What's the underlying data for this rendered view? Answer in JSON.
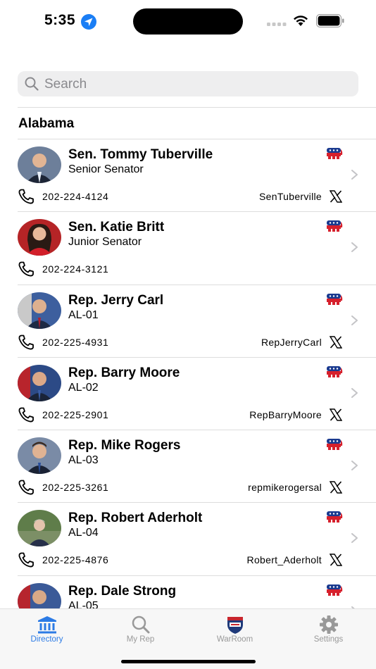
{
  "status_bar": {
    "time": "5:35"
  },
  "search": {
    "placeholder": "Search"
  },
  "section": {
    "header": "Alabama"
  },
  "members": [
    {
      "name": "Sen. Tommy Tuberville",
      "title": "Senior Senator",
      "phone": "202-224-4124",
      "twitter": "SenTuberville",
      "party": "republican"
    },
    {
      "name": "Sen. Katie Britt",
      "title": "Junior Senator",
      "phone": "202-224-3121",
      "twitter": "",
      "party": "republican"
    },
    {
      "name": "Rep. Jerry Carl",
      "title": "AL-01",
      "phone": "202-225-4931",
      "twitter": "RepJerryCarl",
      "party": "republican"
    },
    {
      "name": "Rep. Barry Moore",
      "title": "AL-02",
      "phone": "202-225-2901",
      "twitter": "RepBarryMoore",
      "party": "republican"
    },
    {
      "name": "Rep. Mike Rogers",
      "title": "AL-03",
      "phone": "202-225-3261",
      "twitter": "repmikerogersal",
      "party": "republican"
    },
    {
      "name": "Rep. Robert Aderholt",
      "title": "AL-04",
      "phone": "202-225-4876",
      "twitter": "Robert_Aderholt",
      "party": "republican"
    },
    {
      "name": "Rep. Dale Strong",
      "title": "AL-05",
      "phone": "",
      "twitter": "",
      "party": "republican"
    }
  ],
  "tabs": [
    {
      "label": "Directory",
      "icon": "bank-icon",
      "active": true
    },
    {
      "label": "My Rep",
      "icon": "search-icon",
      "active": false
    },
    {
      "label": "WarRoom",
      "icon": "warroom-icon",
      "active": false
    },
    {
      "label": "Settings",
      "icon": "gear-icon",
      "active": false
    }
  ],
  "colors": {
    "accent": "#2c7be5",
    "republican_red": "#d6202c",
    "republican_blue": "#1a3a8f"
  }
}
